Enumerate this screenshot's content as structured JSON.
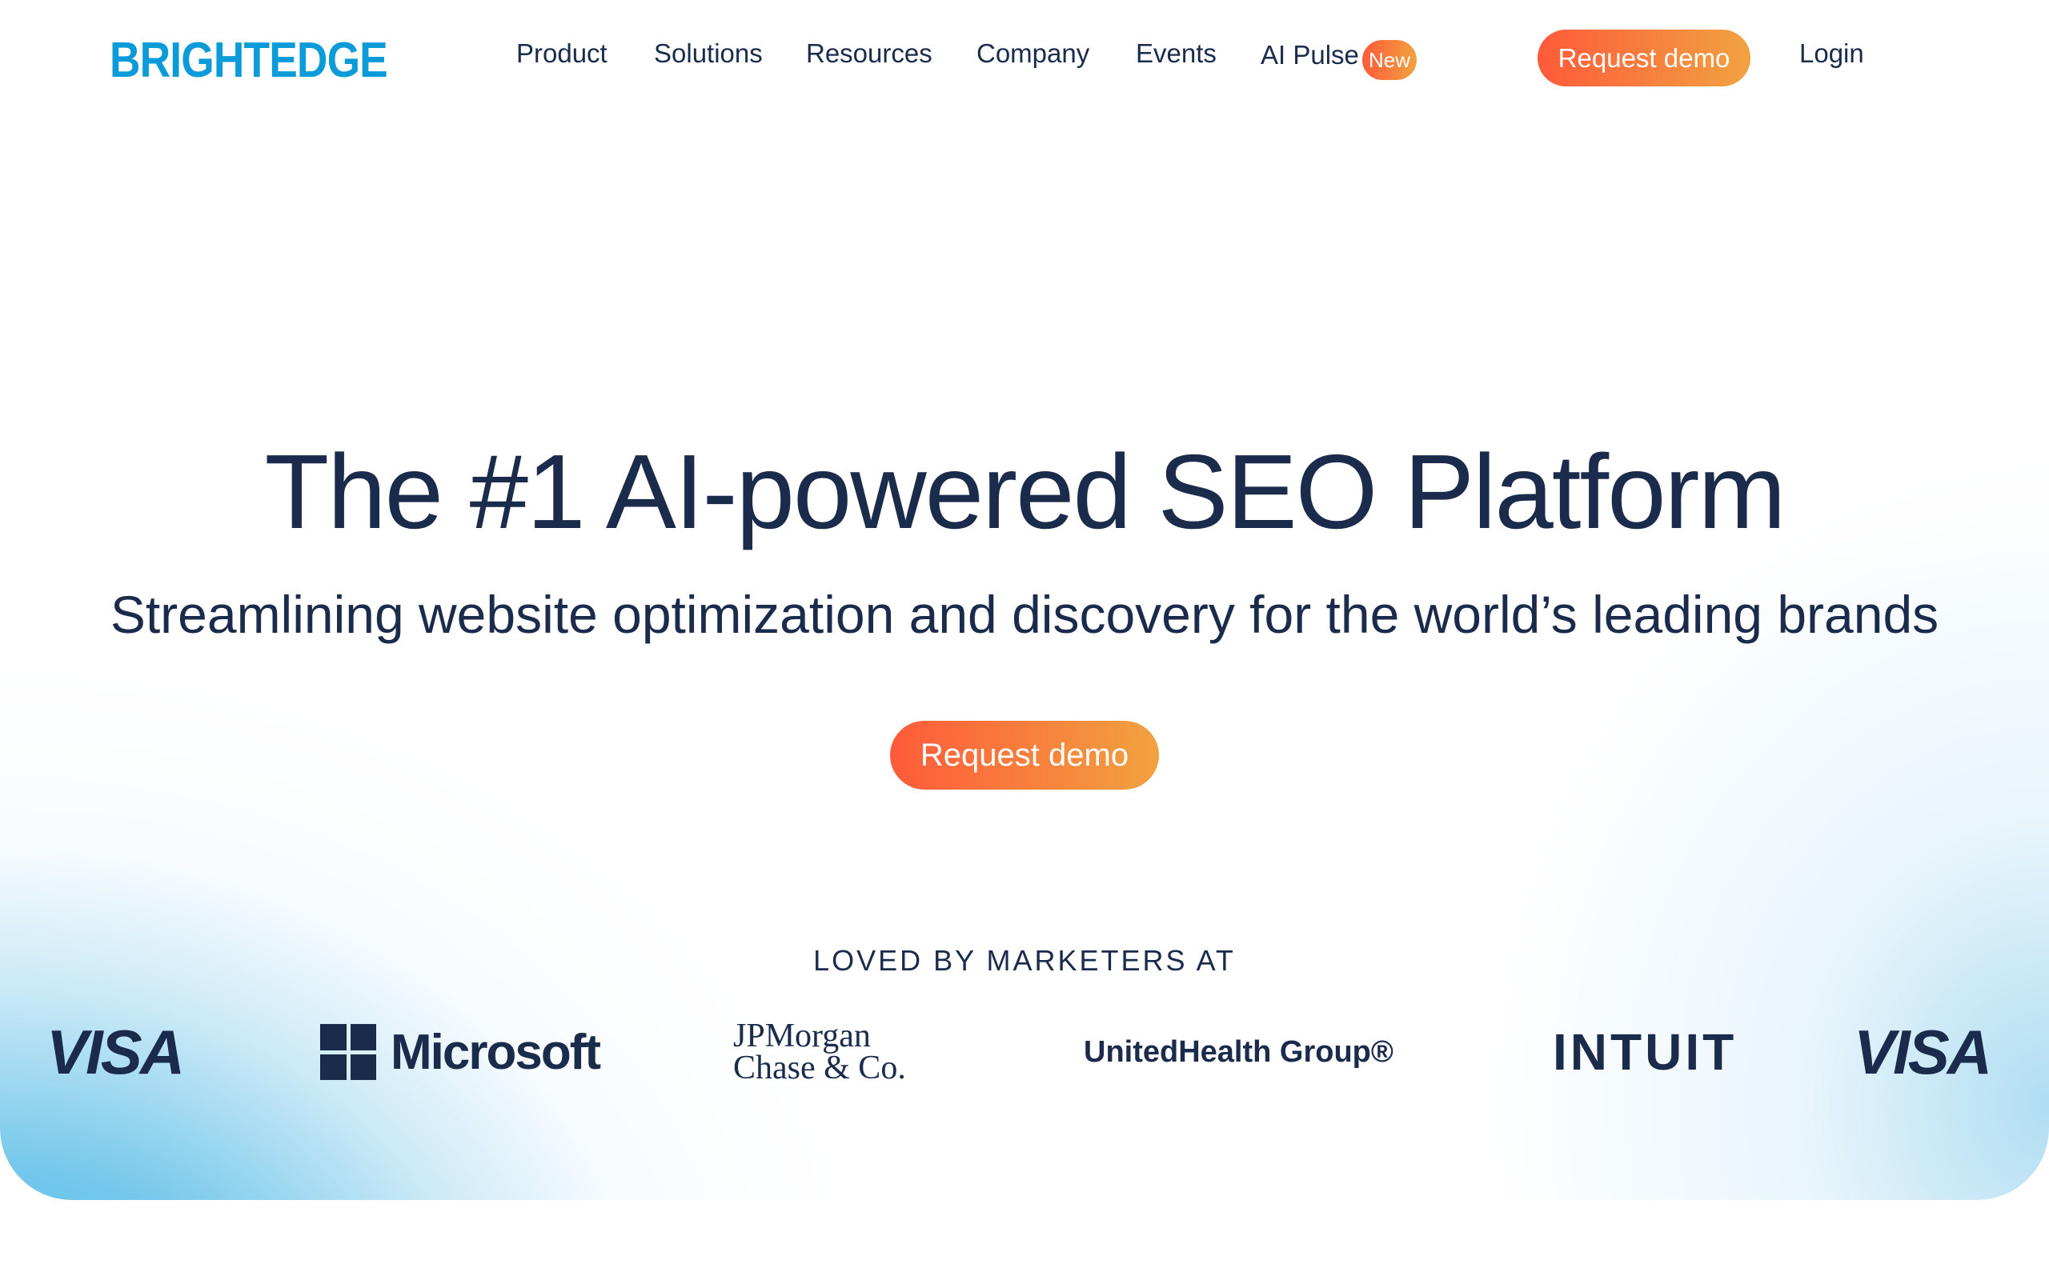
{
  "brand": {
    "logo_text": "BRIGHTEDGE",
    "accent_color": "#0b9bd8"
  },
  "nav": {
    "items": [
      {
        "label": "Product"
      },
      {
        "label": "Solutions"
      },
      {
        "label": "Resources"
      },
      {
        "label": "Company"
      },
      {
        "label": "Events"
      },
      {
        "label": "AI Pulse",
        "badge": "New"
      }
    ],
    "cta_label": "Request demo",
    "login_label": "Login"
  },
  "hero": {
    "headline": "The #1 AI-powered SEO Platform",
    "subheadline": "Streamlining website optimization and discovery for the world’s leading brands",
    "cta_label": "Request demo",
    "gradient_colors": [
      "#ff5a3a",
      "#f1a240"
    ],
    "background_accent": "#40b2e4"
  },
  "social_proof": {
    "heading": "LOVED BY MARKETERS AT",
    "logos": [
      {
        "name": "visa-logo",
        "text": "VISA"
      },
      {
        "name": "microsoft-logo",
        "text": "Microsoft"
      },
      {
        "name": "jpmorgan-logo",
        "line1": "JPMorgan",
        "line2": "Chase & Co."
      },
      {
        "name": "unitedhealth-logo",
        "text": "UnitedHealth Group®"
      },
      {
        "name": "intuit-logo",
        "text": "INTUIT"
      },
      {
        "name": "visa-logo-2",
        "text": "VISA"
      }
    ]
  }
}
